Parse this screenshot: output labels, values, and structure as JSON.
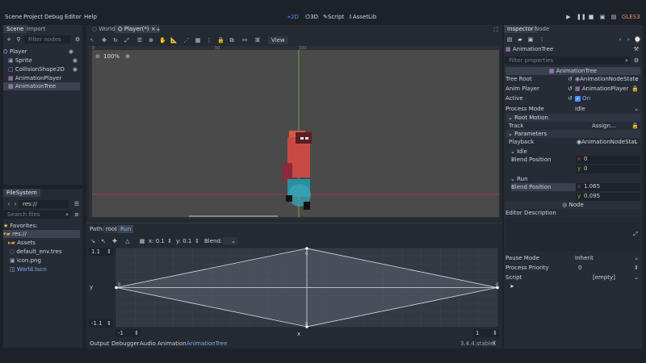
{
  "menubar": {
    "items": [
      "Scene",
      "Project",
      "Debug",
      "Editor",
      "Help"
    ],
    "workspaces": [
      "2D",
      "3D",
      "Script",
      "AssetLib"
    ],
    "renderer": "GLES3"
  },
  "scene_dock": {
    "tabs": [
      "Scene",
      "Import"
    ],
    "filter_placeholder": "Filter nodes",
    "nodes": [
      "Player",
      "Sprite",
      "CollisionShape2D",
      "AnimationPlayer",
      "AnimationTree"
    ],
    "selected": "AnimationTree"
  },
  "filesystem_dock": {
    "title": "FileSystem",
    "path": "res://",
    "search_placeholder": "Search files",
    "items": [
      "Favorites:",
      "res://",
      "Assets",
      "default_env.tres",
      "icon.png",
      "World.tscn"
    ]
  },
  "scene_tabs": [
    "World",
    "Player(*)"
  ],
  "viewport": {
    "zoom": "100%",
    "toolbar_view": "View",
    "ruler_labels": [
      "0",
      "50",
      "100"
    ]
  },
  "anim_tree": {
    "path_label": "Path:",
    "breadcrumb": [
      "root",
      "Run"
    ],
    "x_label": "x: 0.1",
    "y_label": "y: 0.1",
    "blend_label": "Blend:",
    "y_max": "1.1",
    "y_min": "-1.1",
    "y_axis": "y",
    "x_min": "-1",
    "x_max": "1",
    "x_axis": "x",
    "point_labels": [
      "0",
      "0",
      "0",
      "0"
    ]
  },
  "bottom_tabs": [
    "Output",
    "Debugger",
    "Audio",
    "Animation",
    "AnimationTree"
  ],
  "version": "3.4.4.stable",
  "inspector": {
    "tabs": [
      "Inspector",
      "Node"
    ],
    "node_name": "AnimationTree",
    "filter_placeholder": "Filter properties",
    "class_name": "AnimationTree",
    "props": {
      "tree_root_label": "Tree Root",
      "tree_root_value": "AnimationNodeState",
      "anim_player_label": "Anim Player",
      "anim_player_value": "AnimationPlayer",
      "active_label": "Active",
      "active_value": "On",
      "process_mode_label": "Process Mode",
      "process_mode_value": "Idle"
    },
    "root_motion": "Root Motion",
    "track_label": "Track",
    "track_value": "Assign...",
    "parameters": "Parameters",
    "playback_label": "Playback",
    "playback_value": "AnimationNodeStat",
    "idle": "Idle",
    "idle_blend_label": "Blend Position",
    "idle_x": "0",
    "idle_y": "0",
    "run": "Run",
    "run_blend_label": "Blend Position",
    "run_x": "1.065",
    "run_y": "0.095",
    "node_btn": "Node",
    "editor_description": "Editor Description",
    "pause_mode_label": "Pause Mode",
    "pause_mode_value": "Inherit",
    "process_priority_label": "Process Priority",
    "process_priority_value": "0",
    "script_label": "Script",
    "script_value": "[empty]"
  },
  "colors": {
    "accent": "#4b8ff7",
    "bg": "#1d2229",
    "panel": "#262c35",
    "viewport": "#4a4a4a",
    "axis_red": "#c0383a",
    "axis_green": "#6fbf3c"
  },
  "chart_data": {
    "type": "scatter",
    "x": [
      -1,
      0,
      1,
      0
    ],
    "y": [
      0,
      1.1,
      0,
      -1.1
    ],
    "xlim": [
      -1,
      1
    ],
    "ylim": [
      -1.1,
      1.1
    ]
  }
}
